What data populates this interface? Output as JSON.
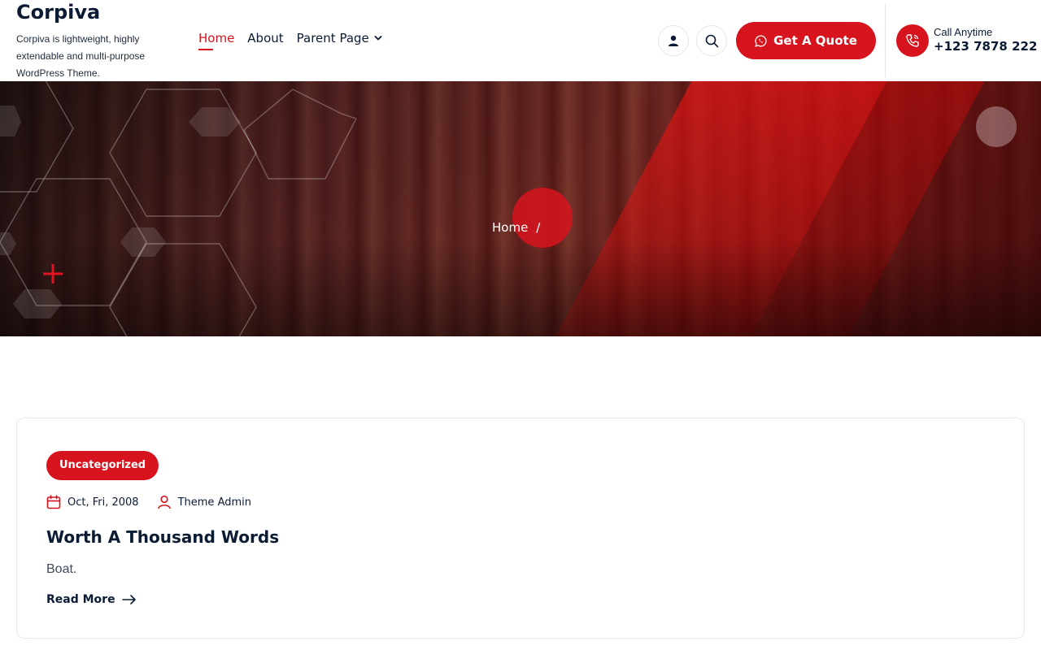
{
  "brand": {
    "title": "Corpiva",
    "description": "Corpiva is lightweight, highly extendable and multi-purpose WordPress Theme."
  },
  "nav": {
    "items": [
      {
        "label": "Home",
        "active": true
      },
      {
        "label": "About",
        "active": false
      },
      {
        "label": "Parent Page",
        "active": false
      }
    ]
  },
  "header_actions": {
    "account_icon": "user-icon",
    "search_icon": "search-icon",
    "quote_label": "Get A Quote",
    "quote_icon": "whatsapp-icon"
  },
  "contact": {
    "label": "Call Anytime",
    "number": "+123 7878 222",
    "icon": "phone-icon"
  },
  "hero": {
    "breadcrumb": [
      {
        "label": "Home"
      },
      {
        "label": "/"
      }
    ]
  },
  "post": {
    "category": "Uncategorized",
    "date": "Oct, Fri, 2008",
    "author": "Theme Admin",
    "title": "Worth A Thousand Words",
    "excerpt": "Boat.",
    "read_more": "Read More"
  },
  "colors": {
    "accent": "#d7131d",
    "text_dark": "#0b1b33"
  }
}
